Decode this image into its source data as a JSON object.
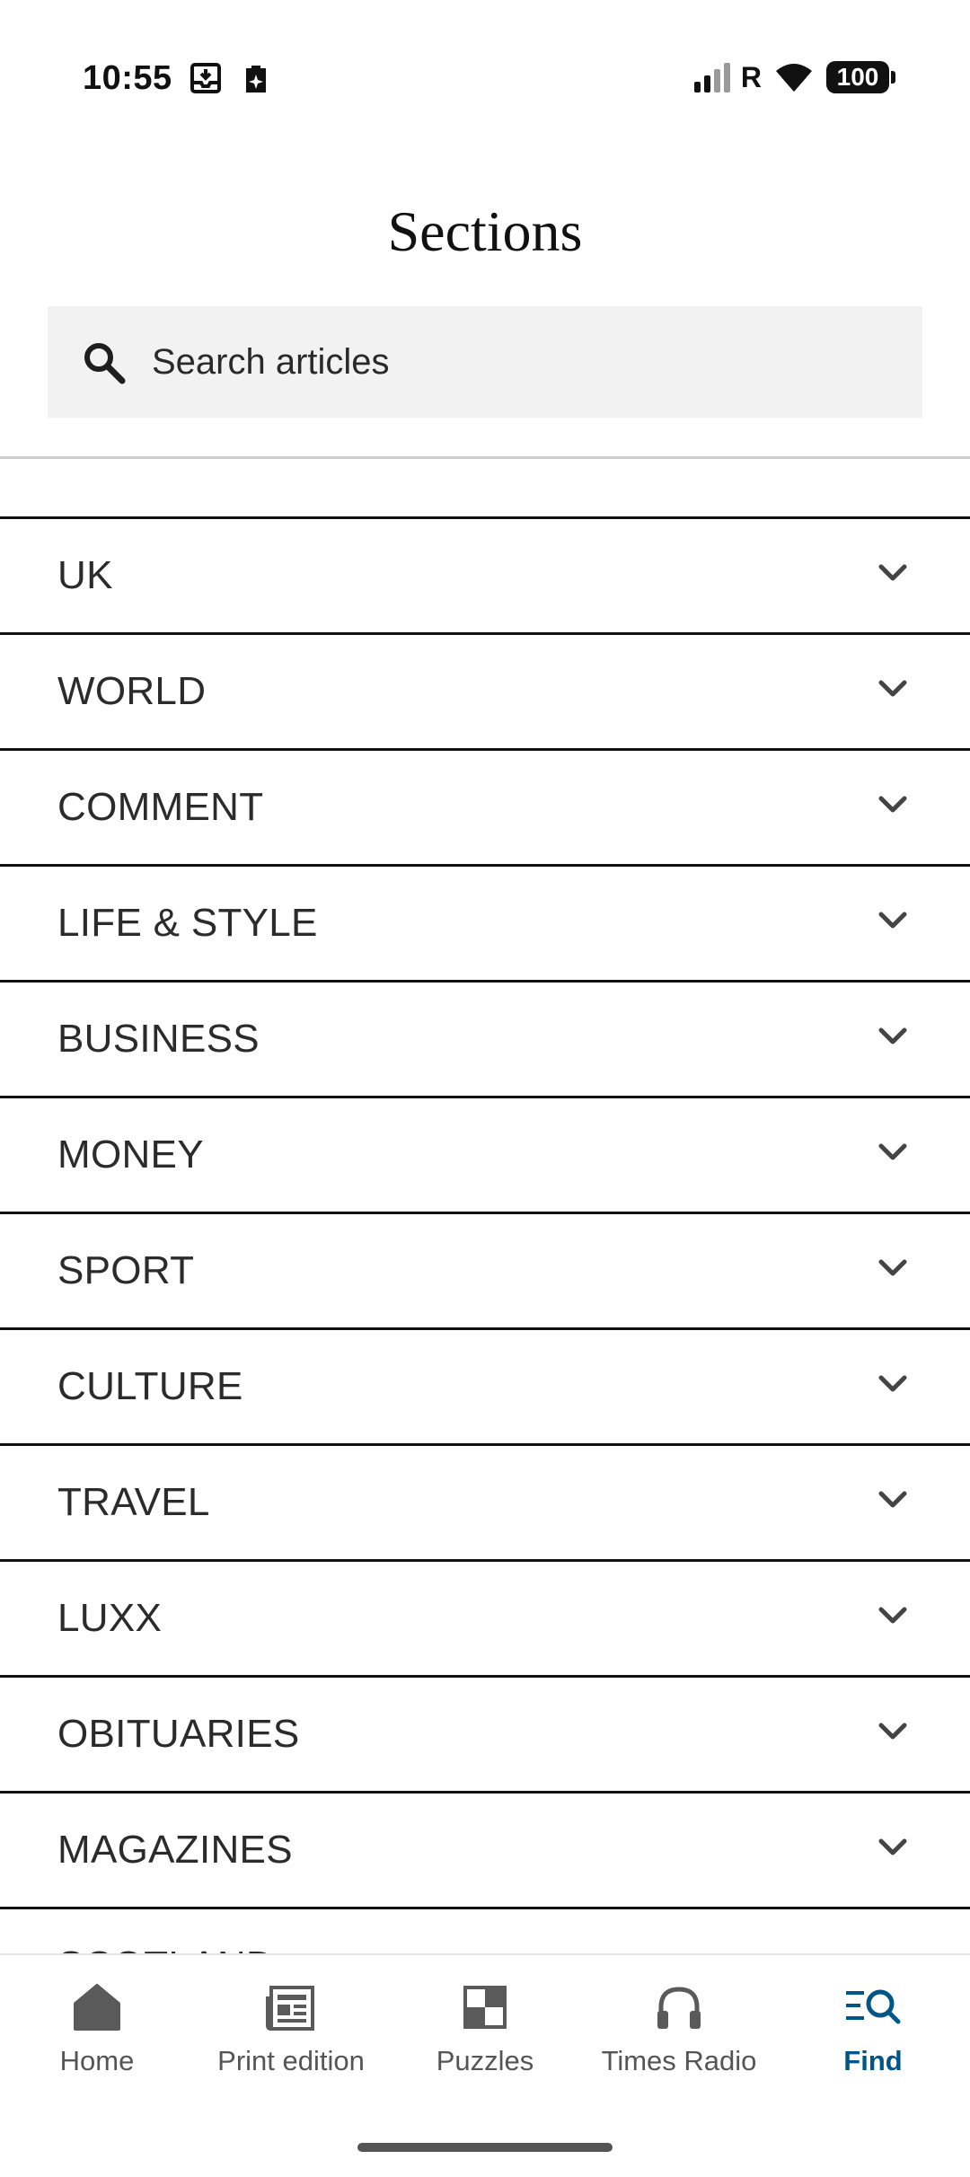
{
  "status_bar": {
    "time": "10:55",
    "battery": "100",
    "left_icons": [
      "download-tray-icon",
      "clipboard-sparkle-icon"
    ],
    "right_icons": [
      "signal-icon",
      "roaming-icon",
      "wifi-icon",
      "battery-icon"
    ],
    "roaming_label": "R"
  },
  "header": {
    "title": "Sections"
  },
  "search": {
    "placeholder": "Search articles",
    "value": ""
  },
  "sections": [
    {
      "label": "UK"
    },
    {
      "label": "WORLD"
    },
    {
      "label": "COMMENT"
    },
    {
      "label": "LIFE & STYLE"
    },
    {
      "label": "BUSINESS"
    },
    {
      "label": "MONEY"
    },
    {
      "label": "SPORT"
    },
    {
      "label": "CULTURE"
    },
    {
      "label": "TRAVEL"
    },
    {
      "label": "LUXX"
    },
    {
      "label": "OBITUARIES"
    },
    {
      "label": "MAGAZINES"
    },
    {
      "label": "SCOTLAND"
    }
  ],
  "bottom_nav": {
    "items": [
      {
        "label": "Home",
        "icon": "home-icon",
        "active": false
      },
      {
        "label": "Print edition",
        "icon": "newspaper-icon",
        "active": false
      },
      {
        "label": "Puzzles",
        "icon": "puzzles-icon",
        "active": false
      },
      {
        "label": "Times Radio",
        "icon": "headphones-icon",
        "active": false
      },
      {
        "label": "Find",
        "icon": "find-icon",
        "active": true
      }
    ]
  },
  "colors": {
    "accent": "#005689",
    "text": "#2b2b2b",
    "divider": "#111111",
    "search_bg": "#f2f2f2",
    "nav_inactive": "#555555"
  }
}
